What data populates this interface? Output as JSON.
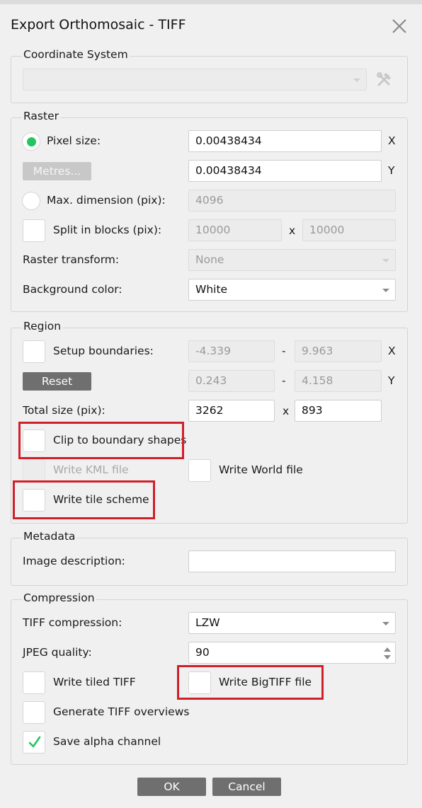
{
  "dialog": {
    "title": "Export Orthomosaic - TIFF",
    "accent_color": "#22c55e",
    "highlight_color": "#d0202a"
  },
  "coordinate_system": {
    "legend": "Coordinate System",
    "value": "",
    "settings_icon": "wrench-hammer-icon"
  },
  "raster": {
    "legend": "Raster",
    "pixel_size_label": "Pixel size:",
    "pixel_size_x": "0.00438434",
    "pixel_size_y": "0.00438434",
    "metres_button": "Metres...",
    "max_dimension_label": "Max. dimension (pix):",
    "max_dimension_value": "4096",
    "split_blocks_label": "Split in blocks (pix):",
    "split_x": "10000",
    "split_y": "10000",
    "raster_transform_label": "Raster transform:",
    "raster_transform_value": "None",
    "background_color_label": "Background color:",
    "background_color_value": "White",
    "axis_x": "X",
    "axis_y": "Y",
    "times": "x"
  },
  "region": {
    "legend": "Region",
    "setup_boundaries_label": "Setup boundaries:",
    "x_min": "-4.339",
    "x_max": "9.963",
    "y_min": "0.243",
    "y_max": "4.158",
    "dash": "-",
    "axis_x": "X",
    "axis_y": "Y",
    "reset_button": "Reset",
    "total_size_label": "Total size (pix):",
    "total_w": "3262",
    "total_h": "893",
    "times": "x",
    "clip_label": "Clip to boundary shapes",
    "kml_label": "Write KML file",
    "world_label": "Write World file",
    "tile_scheme_label": "Write tile scheme"
  },
  "metadata": {
    "legend": "Metadata",
    "image_description_label": "Image description:",
    "image_description_value": ""
  },
  "compression": {
    "legend": "Compression",
    "tiff_compression_label": "TIFF compression:",
    "tiff_compression_value": "LZW",
    "jpeg_quality_label": "JPEG quality:",
    "jpeg_quality_value": "90",
    "tiled_label": "Write tiled TIFF",
    "bigtiff_label": "Write BigTIFF file",
    "overviews_label": "Generate TIFF overviews",
    "alpha_label": "Save alpha channel",
    "alpha_checked": true
  },
  "footer": {
    "ok": "OK",
    "cancel": "Cancel"
  }
}
